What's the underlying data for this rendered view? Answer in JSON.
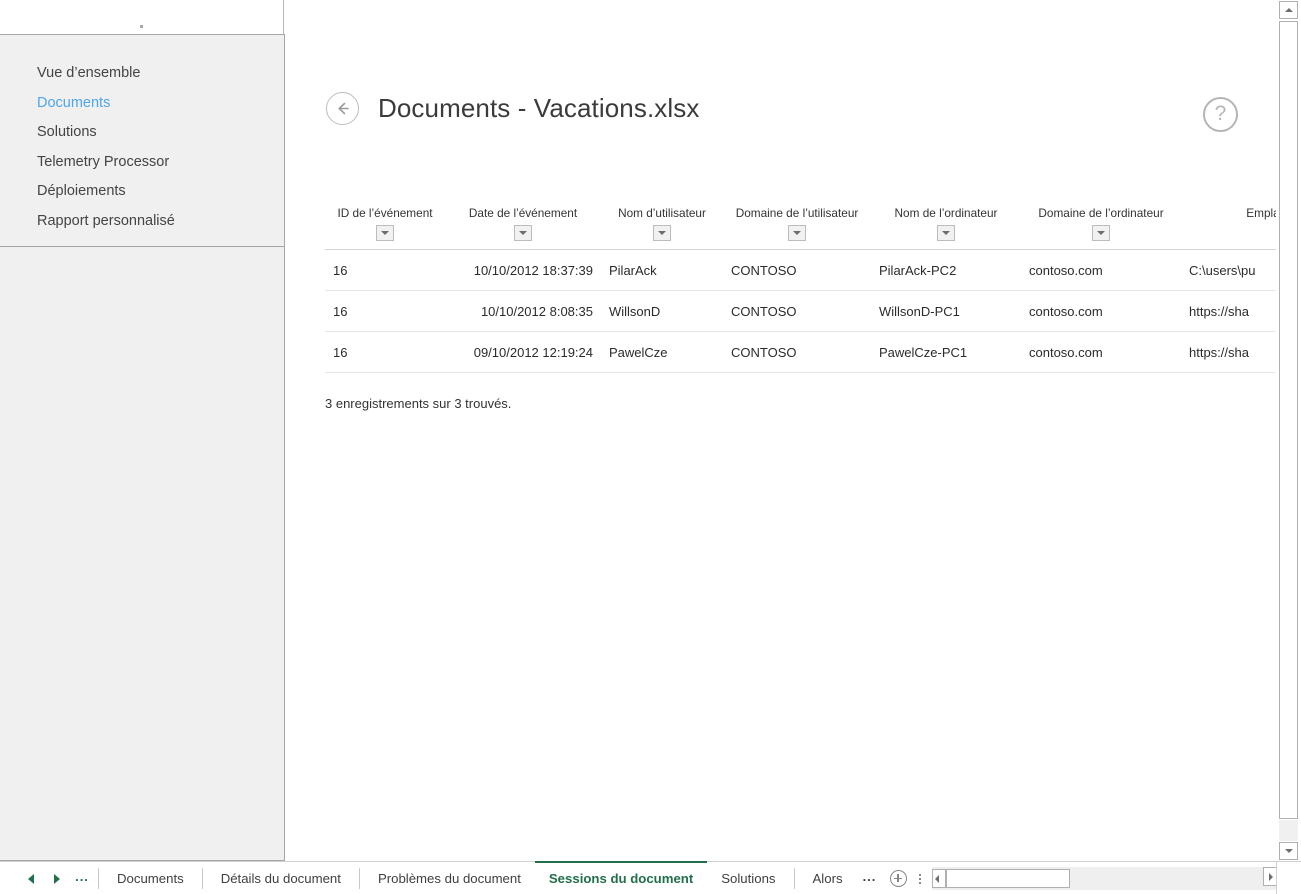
{
  "nav": {
    "items": [
      {
        "label": "Vue d’ensemble",
        "selected": false
      },
      {
        "label": "Documents",
        "selected": true
      },
      {
        "label": "Solutions",
        "selected": false
      },
      {
        "label": "Telemetry Processor",
        "selected": false
      },
      {
        "label": "Déploiements",
        "selected": false
      },
      {
        "label": "Rapport personnalisé",
        "selected": false
      }
    ]
  },
  "header": {
    "back_icon": "back-arrow-icon",
    "title": "Documents - Vacations.xlsx",
    "help_icon": "?"
  },
  "table": {
    "columns": [
      "ID de l’événement",
      "Date de l’événement",
      "Nom d’utilisateur",
      "Domaine de l’utilisateur",
      "Nom de l’ordinateur",
      "Domaine de l’ordinateur",
      "Empla"
    ],
    "rows": [
      {
        "event_id": "16",
        "event_date": "10/10/2012 18:37:39",
        "user_name": "PilarAck",
        "user_domain": "CONTOSO",
        "computer_name": "PilarAck-PC2",
        "computer_domain": "contoso.com",
        "location": "C:\\users\\pu"
      },
      {
        "event_id": "16",
        "event_date": "10/10/2012 8:08:35",
        "user_name": "WillsonD",
        "user_domain": "CONTOSO",
        "computer_name": "WillsonD-PC1",
        "computer_domain": "contoso.com",
        "location": "https://sha"
      },
      {
        "event_id": "16",
        "event_date": "09/10/2012 12:19:24",
        "user_name": "PawelCze",
        "user_domain": "CONTOSO",
        "computer_name": "PawelCze-PC1",
        "computer_domain": "contoso.com",
        "location": "https://sha"
      }
    ],
    "status": "3 enregistrements sur 3 trouvés."
  },
  "tabbar": {
    "prev_icon": "triangle-left-icon",
    "next_icon": "triangle-right-icon",
    "nav_ellipsis": "...",
    "tabs": [
      {
        "label": "Documents",
        "active": false
      },
      {
        "label": "Détails du document",
        "active": false
      },
      {
        "label": "Problèmes du document",
        "active": false
      },
      {
        "label": "Sessions du document",
        "active": true
      },
      {
        "label": "Solutions",
        "active": false
      },
      {
        "label": "Alors",
        "active": false
      }
    ],
    "more_dots": "...",
    "add_sheet_icon": "plus-circle-icon"
  },
  "colors": {
    "accent_green": "#21704a",
    "selected_nav": "#4ea6ea",
    "panel_bg": "#f0f0f0"
  }
}
